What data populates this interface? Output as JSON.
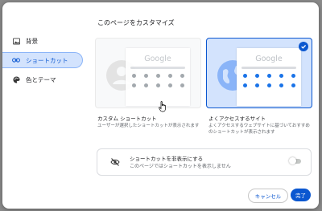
{
  "nav": {
    "items": [
      {
        "label": "背景",
        "icon": "image-icon"
      },
      {
        "label": "ショートカット",
        "icon": "link-icon"
      },
      {
        "label": "色とテーマ",
        "icon": "palette-icon"
      }
    ]
  },
  "main": {
    "title": "このページをカスタマイズ",
    "cards": {
      "custom": {
        "preview_logo": "Google",
        "title": "カスタム ショートカット",
        "desc": "ユーザーが選択したショートカットが表示されます"
      },
      "most": {
        "preview_logo": "Google",
        "title": "よくアクセスするサイト",
        "desc": "よくアクセスするウェブサイトに基づいておすすめのショートカットが表示されます"
      }
    },
    "hide_row": {
      "title": "ショートカットを非表示にする",
      "subtitle": "このページではショートカットを表示しません"
    }
  },
  "footer": {
    "cancel_label": "キャンセル",
    "done_label": "完了"
  },
  "colors": {
    "accent": "#0b57d0",
    "active_bg": "#d3e3fd",
    "backdrop": "#8a8a8a"
  }
}
